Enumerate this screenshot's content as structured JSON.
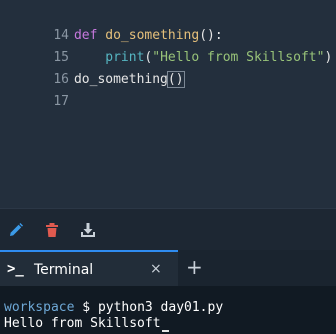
{
  "editor": {
    "lines": [
      {
        "num": "14",
        "kw": "def",
        "fn": "do_something",
        "rest": "():"
      },
      {
        "num": "15",
        "indent": "    ",
        "builtin": "print",
        "open": "(",
        "str": "\"Hello from Skillsoft\"",
        "close": ")"
      },
      {
        "num": "16",
        "call": "do_something",
        "parens": "()"
      },
      {
        "num": "17"
      }
    ]
  },
  "toolbar": {
    "icons": [
      "edit-icon",
      "delete-icon",
      "download-icon"
    ],
    "colors": {
      "edit": "#3b9ae8",
      "delete": "#e05a4f",
      "download": "#c9d1d9"
    }
  },
  "terminal": {
    "tab_label": "Terminal",
    "prompt_glyph": ">_",
    "close_glyph": "×",
    "add_glyph": "+",
    "prompt_user": "workspace",
    "prompt_symbol": "$",
    "command": "python3 day01.py",
    "output": "Hello from Skillsoft"
  },
  "colors": {
    "accent": "#2f8cf0"
  }
}
